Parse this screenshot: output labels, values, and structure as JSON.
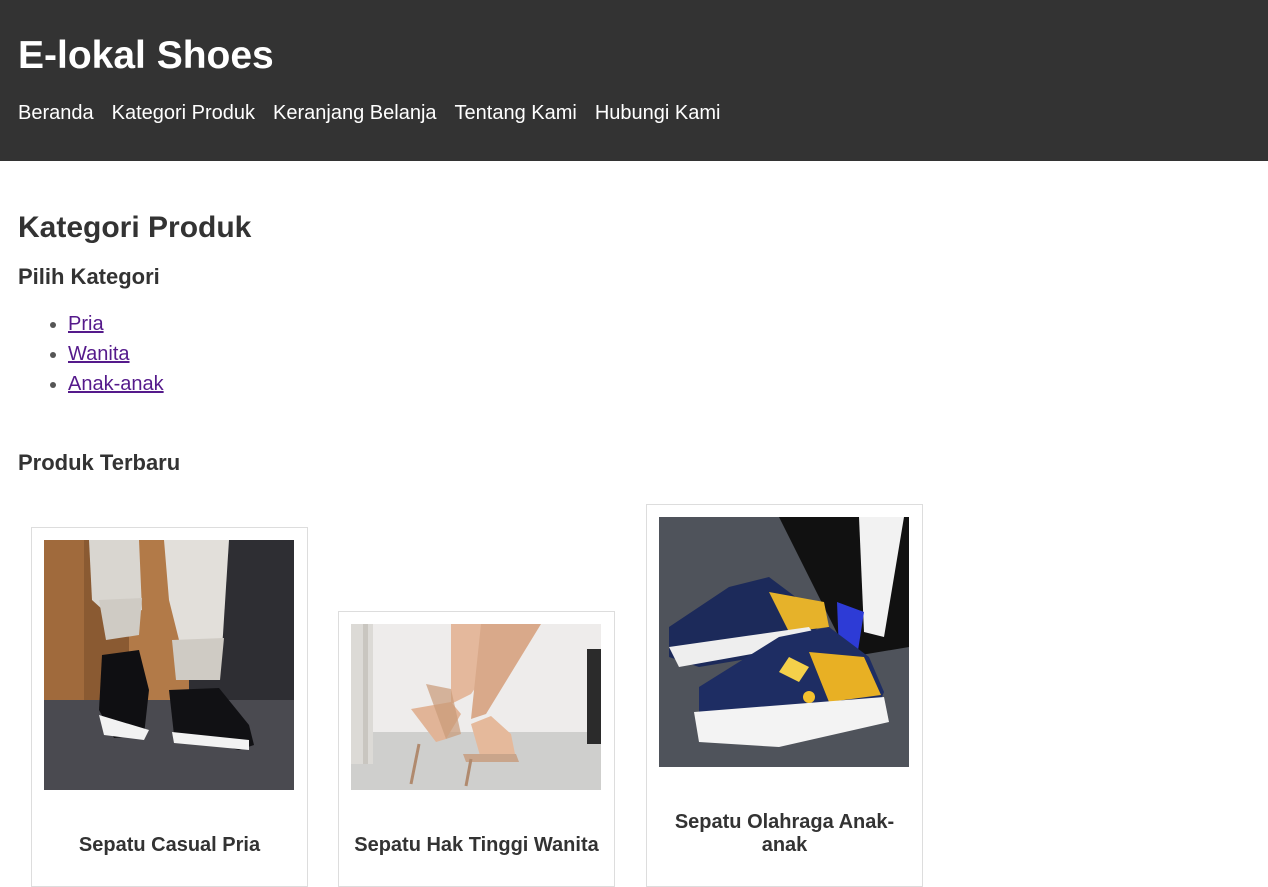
{
  "header": {
    "title": "E-lokal Shoes",
    "nav": [
      "Beranda",
      "Kategori Produk",
      "Keranjang Belanja",
      "Tentang Kami",
      "Hubungi Kami"
    ]
  },
  "main": {
    "title": "Kategori Produk",
    "categories_heading": "Pilih Kategori",
    "categories": [
      "Pria",
      "Wanita",
      "Anak-anak"
    ],
    "latest_heading": "Produk Terbaru",
    "products": [
      {
        "name": "Sepatu Casual Pria"
      },
      {
        "name": "Sepatu Hak Tinggi Wanita"
      },
      {
        "name": "Sepatu Olahraga Anak-anak"
      }
    ]
  },
  "colors": {
    "header_bg": "#333333",
    "link_visited": "#551a8b"
  }
}
